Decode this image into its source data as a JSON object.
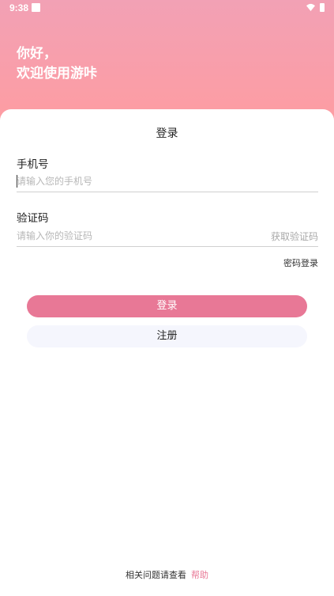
{
  "status_bar": {
    "time": "9:38"
  },
  "hero": {
    "line1": "你好，",
    "line2": "欢迎使用游咔"
  },
  "card": {
    "title": "登录"
  },
  "phone": {
    "label": "手机号",
    "placeholder": "请输入您的手机号",
    "value": ""
  },
  "code": {
    "label": "验证码",
    "placeholder": "请输入你的验证码",
    "value": "",
    "get_code_label": "获取验证码"
  },
  "password_login_label": "密码登录",
  "buttons": {
    "login": "登录",
    "register": "注册"
  },
  "footer": {
    "text": "相关问题请查看",
    "help_link": "帮助"
  },
  "colors": {
    "accent": "#e87896",
    "hero_top": "#f2a1b5",
    "hero_bottom": "#ff9ca0",
    "register_bg": "#f5f6fd"
  },
  "icons": {
    "notification": "notification-square-icon",
    "wifi": "wifi-icon",
    "battery": "battery-icon"
  }
}
